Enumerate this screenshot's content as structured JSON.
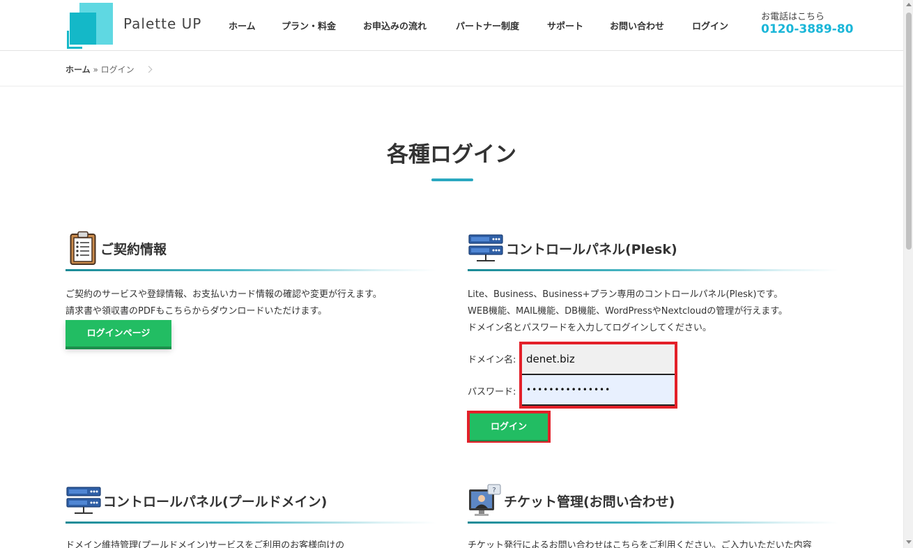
{
  "header": {
    "brand": "Palette UP",
    "nav": [
      "ホーム",
      "プラン・料金",
      "お申込みの流れ",
      "パートナー制度",
      "サポート",
      "お問い合わせ",
      "ログイン"
    ],
    "phone_label": "お電話はこちら",
    "phone_number": "0120-3889-80"
  },
  "breadcrumb": {
    "home": "ホーム",
    "separator": "»",
    "current": "ログイン"
  },
  "page_title": "各種ログイン",
  "sections": {
    "contract": {
      "title": "ご契約情報",
      "lines": [
        "ご契約のサービスや登録情報、お支払いカード情報の確認や変更が行えます。",
        "請求書や領収書のPDFもこちらからダウンロードいただけます。"
      ],
      "button": "ログインページ"
    },
    "plesk": {
      "title": "コントロールパネル(Plesk)",
      "lines": [
        "Lite、Business、Business+プラン専用のコントロールパネル(Plesk)です。",
        "WEB機能、MAIL機能、DB機能、WordPressやNextcloudの管理が行えます。",
        "ドメイン名とパスワードを入力してログインしてください。"
      ],
      "domain_label": "ドメイン名:",
      "domain_value": "denet.biz",
      "password_label": "パスワード:",
      "password_value": "•••••••••••••••",
      "button": "ログイン"
    },
    "pool": {
      "title": "コントロールパネル(プールドメイン)",
      "lines": [
        "ドメイン維持管理(プールドメイン)サービスをご利用のお客様向けの"
      ]
    },
    "ticket": {
      "title": "チケット管理(お問い合わせ)",
      "lines": [
        "チケット発行によるお問い合わせはこちらをご利用ください。ご入力いただいた内容"
      ]
    }
  },
  "colors": {
    "accent": "#1ab6d8",
    "green_button": "#22bd63",
    "highlight_red": "#e32029"
  }
}
